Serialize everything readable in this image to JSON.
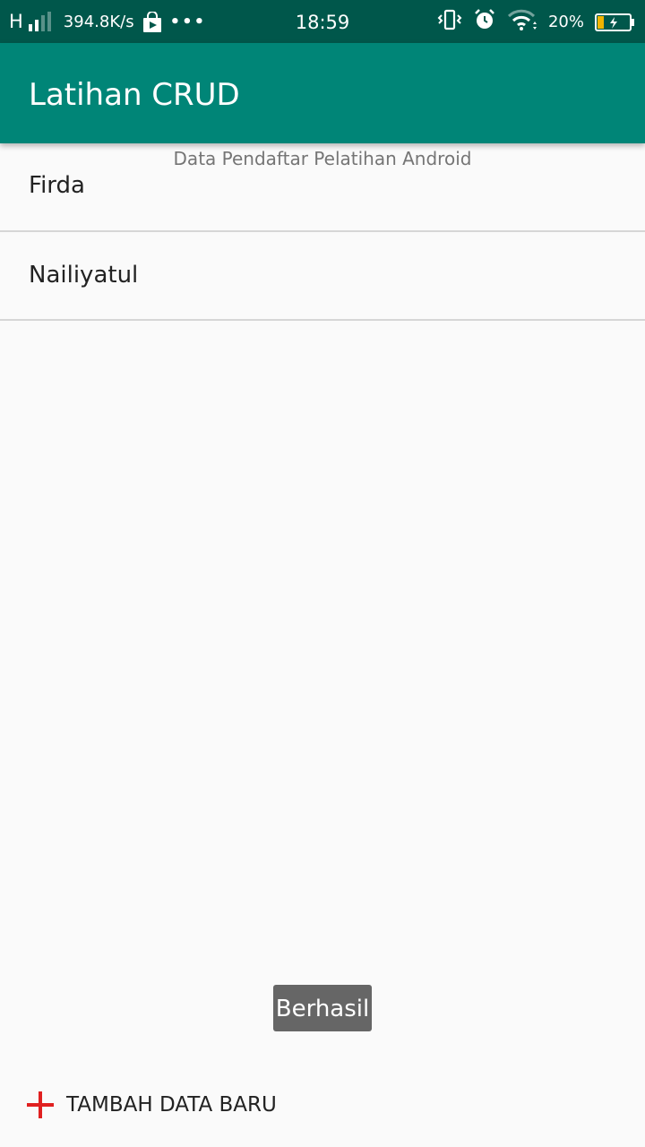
{
  "status_bar": {
    "network_type": "H",
    "speed": "394.8K/s",
    "more": "•••",
    "time": "18:59",
    "battery_percent": "20%",
    "battery_level": 0.2,
    "icons": [
      "signal-icon",
      "play-store-icon",
      "vibrate-icon",
      "alarm-icon",
      "wifi-icon",
      "battery-charging-icon"
    ]
  },
  "app_bar": {
    "title": "Latihan CRUD",
    "color": "#008577"
  },
  "content": {
    "subtitle": "Data Pendaftar Pelatihan Android",
    "items": [
      {
        "label": "Firda"
      },
      {
        "label": "Nailiyatul"
      }
    ]
  },
  "toast": {
    "text": "Berhasil"
  },
  "add_button": {
    "label": "TAMBAH DATA BARU",
    "icon": "plus-icon",
    "icon_color": "#e02020"
  }
}
